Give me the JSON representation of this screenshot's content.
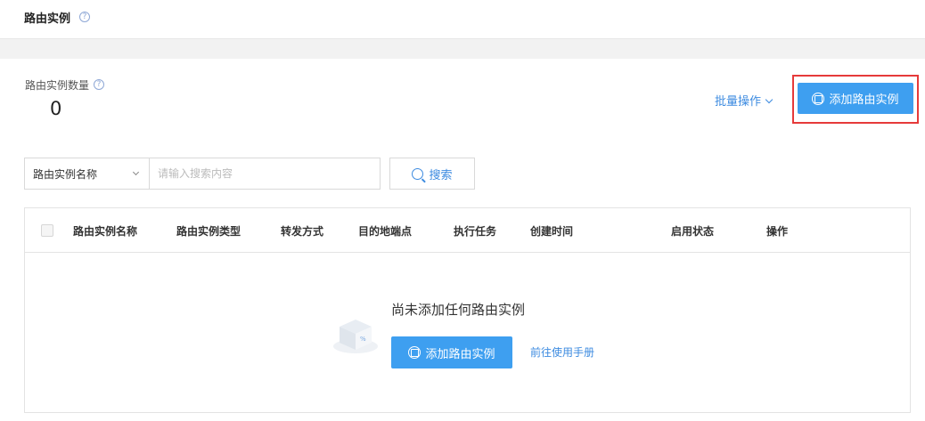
{
  "header": {
    "title": "路由实例"
  },
  "summary": {
    "count_label": "路由实例数量",
    "count_value": "0",
    "batch_label": "批量操作",
    "add_label": "添加路由实例"
  },
  "filter": {
    "field_selected": "路由实例名称",
    "placeholder": "请输入搜索内容",
    "search_label": "搜索"
  },
  "table": {
    "columns": [
      "路由实例名称",
      "路由实例类型",
      "转发方式",
      "目的地端点",
      "执行任务",
      "创建时间",
      "启用状态",
      "操作"
    ]
  },
  "empty": {
    "message": "尚未添加任何路由实例",
    "add_label": "添加路由实例",
    "manual_link": "前往使用手册"
  },
  "colors": {
    "primary": "#3e9ff0",
    "link": "#3d8be0",
    "highlight": "#e63a3a"
  }
}
